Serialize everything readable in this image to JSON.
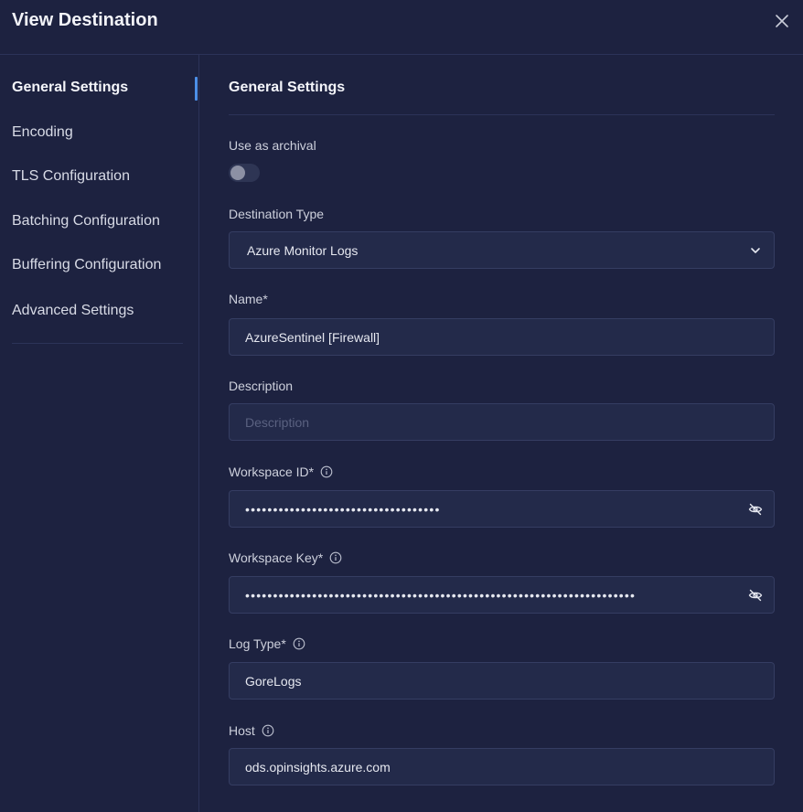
{
  "header": {
    "title": "View Destination"
  },
  "sidebar": {
    "items": [
      {
        "label": "General Settings",
        "active": true
      },
      {
        "label": "Encoding"
      },
      {
        "label": "TLS Configuration"
      },
      {
        "label": "Batching Configuration"
      },
      {
        "label": "Buffering Configuration"
      },
      {
        "label": "Advanced Settings"
      }
    ]
  },
  "main": {
    "section_title": "General Settings",
    "archival": {
      "label": "Use as archival",
      "enabled": false
    },
    "destination_type": {
      "label": "Destination Type",
      "value": "Azure Monitor Logs"
    },
    "name": {
      "label": "Name*",
      "value": "AzureSentinel [Firewall]"
    },
    "description": {
      "label": "Description",
      "value": "",
      "placeholder": "Description"
    },
    "workspace_id": {
      "label": "Workspace ID*",
      "masked": "•••••••••••••••••••••••••••••••••••"
    },
    "workspace_key": {
      "label": "Workspace Key*",
      "masked": "••••••••••••••••••••••••••••••••••••••••••••••••••••••••••••••••••••••"
    },
    "log_type": {
      "label": "Log Type*",
      "value": "GoreLogs"
    },
    "host": {
      "label": "Host",
      "value": "ods.opinsights.azure.com"
    }
  },
  "icons": {
    "close": "close-icon",
    "chevron": "chevron-down-icon",
    "info": "info-icon",
    "eye_off": "eye-off-icon"
  },
  "colors": {
    "background": "#1d2240",
    "accent": "#4c8fe8",
    "field_bg": "#232a4a"
  }
}
